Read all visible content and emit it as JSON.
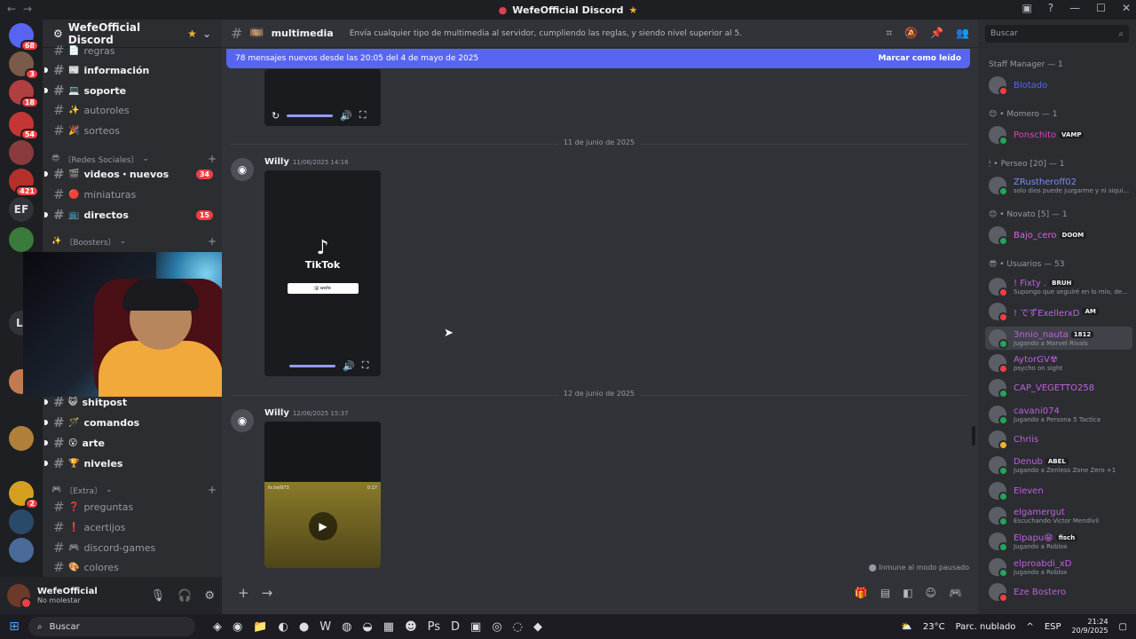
{
  "window": {
    "title": "WefeOfficial Discord",
    "title_star": "★"
  },
  "servers": [
    {
      "badge": "68",
      "color": "#5865f2"
    },
    {
      "badge": "3",
      "color": "#7a5a48"
    },
    {
      "badge": "18",
      "color": "#b04040"
    },
    {
      "badge": "54",
      "color": "#c43535"
    },
    {
      "badge": "",
      "color": "#8a3b3b"
    },
    {
      "badge": "421",
      "color": "#b5302a"
    },
    {
      "badge": "",
      "text": "EF"
    },
    {
      "badge": "",
      "color": "#3a7a3a"
    },
    {
      "badge": "",
      "text": "LI"
    },
    {
      "badge": "",
      "color": "#c47a50"
    },
    {
      "badge": "",
      "color": "#b0803a"
    },
    {
      "badge": "2",
      "color": "#d4a020"
    },
    {
      "badge": "",
      "color": "#2a4a6a"
    },
    {
      "badge": "",
      "color": "#4a6a9a"
    }
  ],
  "guild": {
    "name": "WefeOfficial Discord",
    "star": "★"
  },
  "channels": [
    {
      "emoji": "📄",
      "name": "regras",
      "unread": false
    },
    {
      "emoji": "📰",
      "name": "información",
      "unread": true
    },
    {
      "emoji": "💻",
      "name": "soporte",
      "unread": true
    },
    {
      "emoji": "✨",
      "name": "autoroles",
      "unread": false
    },
    {
      "emoji": "🎉",
      "name": "sorteos",
      "unread": false
    },
    {
      "emoji": "🎬",
      "name": "videos・nuevos",
      "unread": true,
      "count": "34"
    },
    {
      "emoji": "🔴",
      "name": "miniaturas",
      "unread": false
    },
    {
      "emoji": "📺",
      "name": "directos",
      "unread": true,
      "count": "15"
    },
    {
      "emoji": "😺",
      "name": "shitpost",
      "unread": true
    },
    {
      "emoji": "🪄",
      "name": "comandos",
      "unread": true
    },
    {
      "emoji": "😮",
      "name": "arte",
      "unread": true
    },
    {
      "emoji": "🏆",
      "name": "niveles",
      "unread": true
    },
    {
      "emoji": "❓",
      "name": "preguntas",
      "unread": false
    },
    {
      "emoji": "❗",
      "name": "acertijos",
      "unread": false
    },
    {
      "emoji": "🎮",
      "name": "discord-games",
      "unread": false
    },
    {
      "emoji": "🎨",
      "name": "colores",
      "unread": false
    }
  ],
  "categories": {
    "redes": "〔Redes Sociales〕",
    "boosters": "〔Boosters〕",
    "extra": "〔Extra〕"
  },
  "user": {
    "name": "WefeOfficial",
    "status": "No molestar"
  },
  "header": {
    "channel": "multimedia",
    "channel_emoji": "🎞️",
    "topic": "Envía cualquier tipo de multimedia al servidor, cumpliendo las reglas, y siendo nivel superior al 5."
  },
  "newbar": {
    "text": "78 mensajes nuevos desde las 20:05 del 4 de mayo de 2025",
    "action": "Marcar como leído"
  },
  "dividers": [
    "11 de junio de 2025",
    "12 de junio de 2025"
  ],
  "messages": [
    {
      "author": "Willy",
      "time": "11/06/2025 14:16"
    },
    {
      "author": "Willy",
      "time": "12/06/2025 15:37"
    }
  ],
  "tiktok": {
    "word": "TikTok",
    "handle": "@ wefe"
  },
  "video3": {
    "tag": "fx.tiel973",
    "duration": "0:17"
  },
  "paused_text": "Inmune al modo pausado",
  "members": {
    "search_placeholder": "Buscar",
    "groups": [
      {
        "label": "Staff Manager — 1"
      },
      {
        "label": "😊 • Momero — 1"
      },
      {
        "label": "🕯 • Perseo [20] — 1"
      },
      {
        "label": "😊 • Novato [5] — 1"
      },
      {
        "label": "😎 • Usuarios — 53"
      }
    ],
    "list": [
      {
        "name": "Blotado",
        "color": "#5865f2",
        "sub": "",
        "tag": "",
        "status": "#f23f43"
      },
      {
        "name": "Ponschito",
        "color": "#e040c0",
        "sub": "",
        "tag": "VAMP",
        "status": "#23a55a"
      },
      {
        "name": "ZRustheroff02",
        "color": "#7a8cff",
        "sub": "solo dios puede juzgarme y ni siqui...",
        "tag": "",
        "status": "#23a55a"
      },
      {
        "name": "Bajo_cero",
        "color": "#e060e0",
        "sub": "",
        "tag": "DOOM",
        "status": "#23a55a"
      },
      {
        "name": "! Fixty .",
        "color": "#c060e0",
        "sub": "Supongo que seguiré en lo mío, de...",
        "tag": "BRUH",
        "status": "#f23f43"
      },
      {
        "name": "! でずExellerxD",
        "color": "#c060e0",
        "sub": "",
        "tag": "AM",
        "status": "#f23f43"
      },
      {
        "name": "3nnio_nauta",
        "color": "#c060e0",
        "sub": "Jugando a Marvel Rivals",
        "tag": "1812",
        "status": "#23a55a"
      },
      {
        "name": "AytorGV☢",
        "color": "#c060e0",
        "sub": "psycho on sight",
        "tag": "",
        "status": "#f23f43"
      },
      {
        "name": "CAP_VEGETTO258",
        "color": "#c060e0",
        "sub": "",
        "tag": "",
        "status": "#23a55a"
      },
      {
        "name": "cavani074",
        "color": "#c060e0",
        "sub": "Jugando a Persona 5 Tactica",
        "tag": "",
        "status": "#23a55a"
      },
      {
        "name": "Chriis",
        "color": "#c060e0",
        "sub": "",
        "tag": "",
        "status": "#f0b232"
      },
      {
        "name": "Denub",
        "color": "#c060e0",
        "sub": "Jugando a Zenless Zone Zero +1",
        "tag": "ABEL",
        "status": "#23a55a"
      },
      {
        "name": "Eleven",
        "color": "#c060e0",
        "sub": "",
        "tag": "",
        "status": "#23a55a"
      },
      {
        "name": "elgamergut",
        "color": "#c060e0",
        "sub": "Escuchando Victor Mendivil",
        "tag": "",
        "status": "#23a55a"
      },
      {
        "name": "Elpapu😁",
        "color": "#c060e0",
        "sub": "Jugando a Roblox",
        "tag": "fisch",
        "status": "#23a55a"
      },
      {
        "name": "elproabdi_xD",
        "color": "#c060e0",
        "sub": "Jugando a Roblox",
        "tag": "",
        "status": "#23a55a"
      },
      {
        "name": "Eze Bostero",
        "color": "#c060e0",
        "sub": "",
        "tag": "",
        "status": "#f23f43"
      }
    ]
  },
  "taskbar": {
    "search": "Buscar",
    "weather": "23°C",
    "weather_desc": "Parc. nublado",
    "lang": "ESP",
    "time": "21:24",
    "date": "20/9/2025"
  }
}
